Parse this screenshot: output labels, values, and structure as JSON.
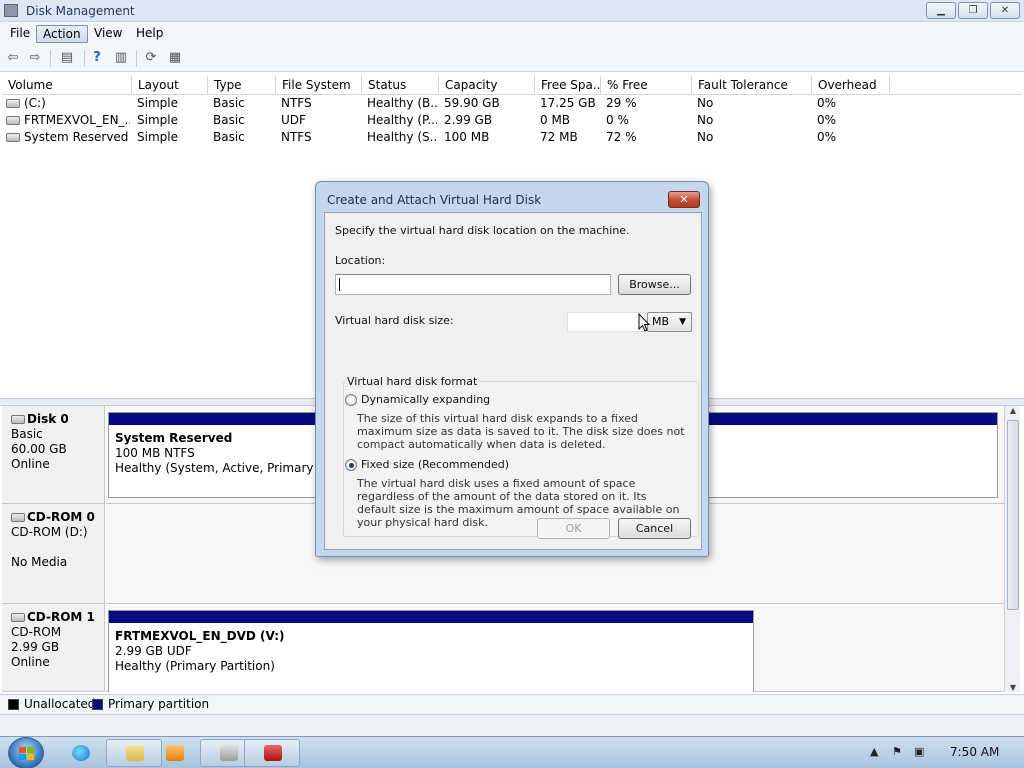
{
  "window": {
    "title": "Disk Management",
    "minimize": "▁",
    "maximize": "❐",
    "close": "✕"
  },
  "menu": [
    "File",
    "Action",
    "View",
    "Help"
  ],
  "volume_columns": [
    "Volume",
    "Layout",
    "Type",
    "File System",
    "Status",
    "Capacity",
    "Free Spa...",
    "% Free",
    "Fault Tolerance",
    "Overhead"
  ],
  "volumes": [
    [
      "(C:)",
      "Simple",
      "Basic",
      "NTFS",
      "Healthy (B...",
      "59.90 GB",
      "17.25 GB",
      "29 %",
      "No",
      "0%"
    ],
    [
      "FRTMEXVOL_EN_...",
      "Simple",
      "Basic",
      "UDF",
      "Healthy (P...",
      "2.99 GB",
      "0 MB",
      "0 %",
      "No",
      "0%"
    ],
    [
      "System Reserved",
      "Simple",
      "Basic",
      "NTFS",
      "Healthy (S...",
      "100 MB",
      "72 MB",
      "72 %",
      "No",
      "0%"
    ]
  ],
  "disks": [
    {
      "name": "Disk 0",
      "type": "Basic",
      "size": "60.00 GB",
      "state": "Online",
      "partition": {
        "name": "System Reserved",
        "info": "100 MB NTFS",
        "status": "Healthy (System, Active, Primary Partiti"
      }
    },
    {
      "name": "CD-ROM 0",
      "type": "CD-ROM (D:)",
      "media": "No Media"
    },
    {
      "name": "CD-ROM 1",
      "type": "CD-ROM",
      "size": "2.99 GB",
      "state": "Online",
      "partition": {
        "name": "FRTMEXVOL_EN_DVD  (V:)",
        "info": "2.99 GB UDF",
        "status": "Healthy (Primary Partition)"
      }
    }
  ],
  "legend": {
    "unallocated": "Unallocated",
    "primary": "Primary partition",
    "unallocated_color": "#000000",
    "primary_color": "#0a0a80"
  },
  "dialog": {
    "title": "Create and Attach Virtual Hard Disk",
    "close": "✕",
    "intro": "Specify the virtual hard disk location on the machine.",
    "location_label": "Location:",
    "location_value": "",
    "browse": "Browse...",
    "size_label": "Virtual hard disk size:",
    "size_value": "",
    "unit": "MB",
    "format_label": "Virtual hard disk format",
    "option_dynamic": "Dynamically expanding",
    "option_dynamic_desc": "The size of this virtual hard disk expands to a fixed maximum size as data is saved to it.  The disk size does not compact automatically when data is deleted.",
    "option_fixed": "Fixed size (Recommended)",
    "option_fixed_desc": "The virtual hard disk uses a fixed amount of space regardless of the amount of the data stored on it.  Its default size is the maximum amount of space available on your physical hard disk.",
    "selected": "fixed",
    "ok": "OK",
    "cancel": "Cancel"
  },
  "taskbar": {
    "time": "7:50 AM",
    "tray_arrow": "▲"
  }
}
